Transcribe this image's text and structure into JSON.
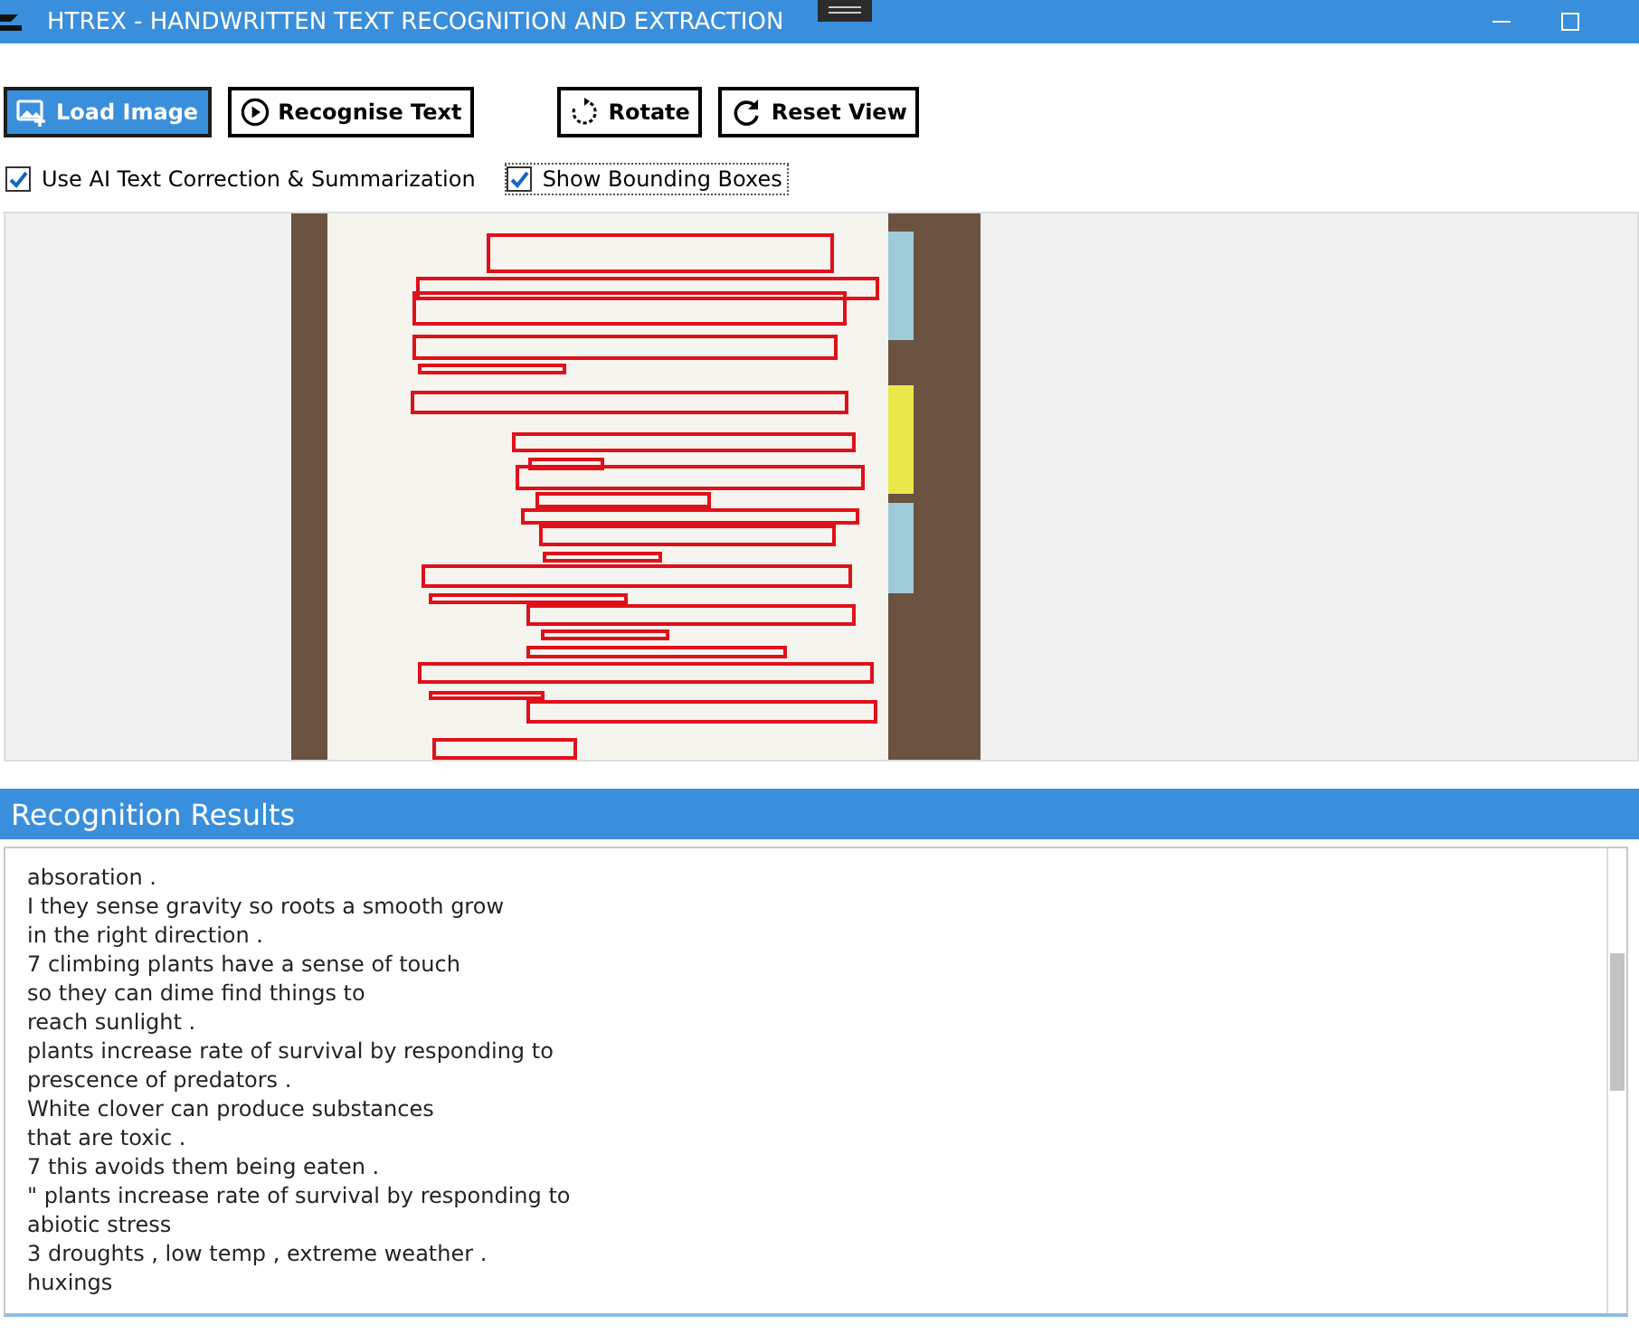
{
  "window": {
    "title": "HTREX - HANDWRITTEN TEXT RECOGNITION AND EXTRACTION"
  },
  "toolbar": {
    "buttons": [
      {
        "label": "Load Image",
        "kind": "load",
        "selected": true
      },
      {
        "label": "Recognise Text",
        "kind": "play",
        "selected": false
      },
      {
        "label": "Rotate",
        "kind": "rotate",
        "selected": false
      },
      {
        "label": "Reset View",
        "kind": "reset",
        "selected": false
      }
    ]
  },
  "options": [
    {
      "label": "Use AI Text Correction & Summarization",
      "checked": true,
      "focused": false
    },
    {
      "label": "Show Bounding Boxes",
      "checked": true,
      "focused": true
    }
  ],
  "results": {
    "title": "Recognition Results",
    "lines": [
      "absoration .",
      "I they sense gravity so roots a smooth grow",
      "in the right direction .",
      "7 climbing plants have a sense of touch",
      "so they can dime find things to",
      "reach sunlight .",
      "plants increase rate of survival by responding to",
      "prescence of predators .",
      "White clover can produce substances",
      "that are toxic .",
      "7 this avoids them being eaten .",
      "\" plants increase rate of survival by responding to",
      "abiotic stress",
      "3 droughts , low temp , extreme weather .",
      "huxings"
    ]
  }
}
